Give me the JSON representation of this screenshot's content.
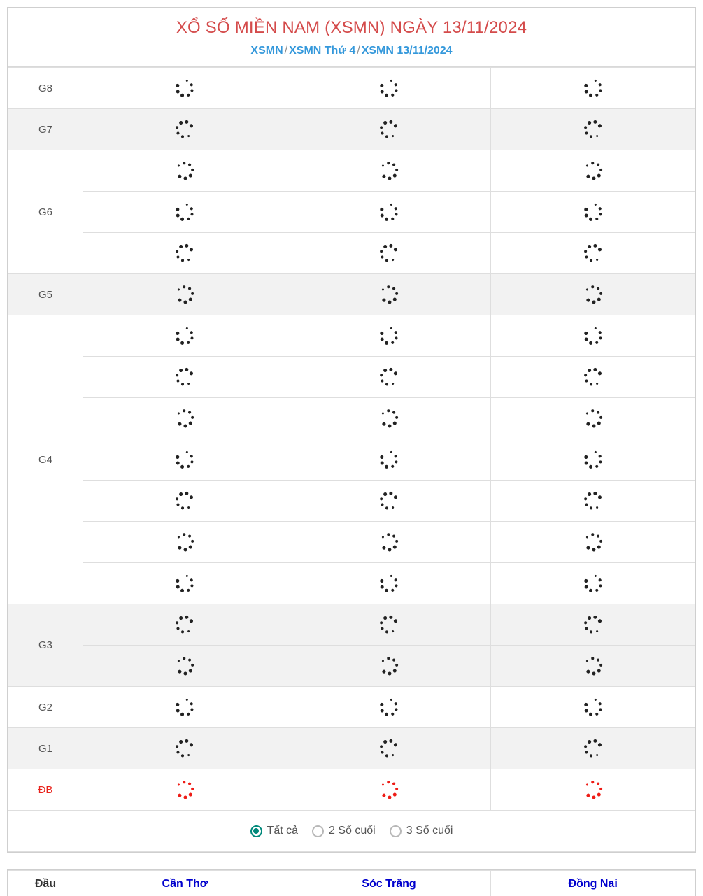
{
  "header": {
    "title": "XỔ SỐ MIỀN NAM (XSMN) NGÀY 13/11/2024",
    "breadcrumb": [
      {
        "label": "XSMN"
      },
      {
        "label": "XSMN Thứ 4"
      },
      {
        "label": "XSMN 13/11/2024"
      }
    ],
    "separator": "/"
  },
  "colors": {
    "title": "#d44b4b",
    "link": "#3498db",
    "special_prize": "#e8231c",
    "radio_selected": "#00897b",
    "bottom_link": "#0000cd"
  },
  "results_table": {
    "loading": true,
    "spinner_icon": "loading-spinner-icon",
    "provinces_count": 3,
    "rows": [
      {
        "label": "G8",
        "span": 1,
        "shaded": false,
        "spinner_color": "dark"
      },
      {
        "label": "G7",
        "span": 1,
        "shaded": true,
        "spinner_color": "dark"
      },
      {
        "label": "G6",
        "span": 3,
        "shaded": false,
        "spinner_color": "dark"
      },
      {
        "label": "G5",
        "span": 1,
        "shaded": true,
        "spinner_color": "dark"
      },
      {
        "label": "G4",
        "span": 7,
        "shaded": false,
        "spinner_color": "dark"
      },
      {
        "label": "G3",
        "span": 2,
        "shaded": true,
        "spinner_color": "dark"
      },
      {
        "label": "G2",
        "span": 1,
        "shaded": false,
        "spinner_color": "dark"
      },
      {
        "label": "G1",
        "span": 1,
        "shaded": true,
        "spinner_color": "dark"
      },
      {
        "label": "ĐB",
        "span": 1,
        "shaded": false,
        "spinner_color": "red"
      }
    ]
  },
  "filter": {
    "options": [
      {
        "label": "Tất cả",
        "selected": true
      },
      {
        "label": "2 Số cuối",
        "selected": false
      },
      {
        "label": "3 Số cuối",
        "selected": false
      }
    ]
  },
  "dau_duoi_table": {
    "header_label": "Đầu",
    "provinces": [
      {
        "label": "Cần Thơ"
      },
      {
        "label": "Sóc Trăng"
      },
      {
        "label": "Đồng Nai"
      }
    ]
  }
}
